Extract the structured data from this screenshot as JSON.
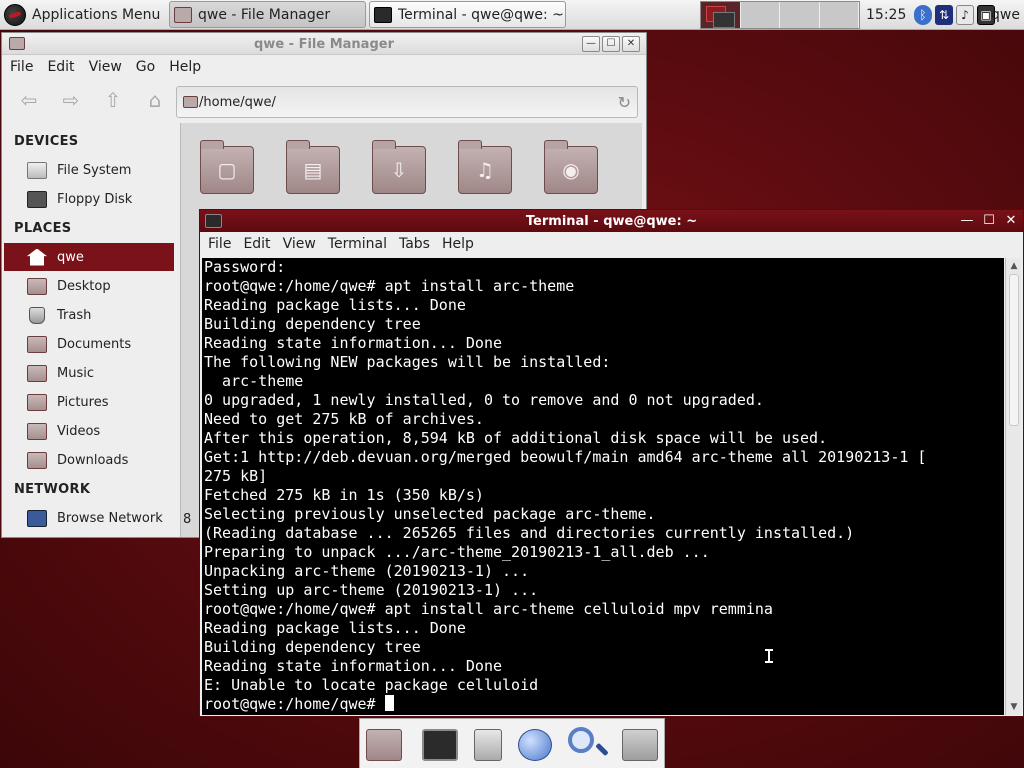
{
  "panel": {
    "app_menu_label": "Applications Menu",
    "tasks": [
      {
        "label": "qwe - File Manager",
        "icon": "file-manager-icon"
      },
      {
        "label": "Terminal - qwe@qwe: ~",
        "icon": "terminal-icon"
      }
    ],
    "clock": "15:25",
    "user": "qwe"
  },
  "file_manager": {
    "title": "qwe - File Manager",
    "menu": [
      "File",
      "Edit",
      "View",
      "Go",
      "Help"
    ],
    "path": "/home/qwe/",
    "sidebar": {
      "devices_header": "DEVICES",
      "devices": [
        {
          "label": "File System",
          "icon": "drive-icon"
        },
        {
          "label": "Floppy Disk",
          "icon": "floppy-icon"
        }
      ],
      "places_header": "PLACES",
      "places": [
        {
          "label": "qwe",
          "icon": "home-icon",
          "selected": true
        },
        {
          "label": "Desktop",
          "icon": "folder-icon"
        },
        {
          "label": "Trash",
          "icon": "trash-icon"
        },
        {
          "label": "Documents",
          "icon": "folder-icon"
        },
        {
          "label": "Music",
          "icon": "folder-icon"
        },
        {
          "label": "Pictures",
          "icon": "folder-icon"
        },
        {
          "label": "Videos",
          "icon": "folder-icon"
        },
        {
          "label": "Downloads",
          "icon": "folder-icon"
        }
      ],
      "network_header": "NETWORK",
      "network": [
        {
          "label": "Browse Network",
          "icon": "network-icon"
        }
      ]
    },
    "status_fragment": "8",
    "accent_color": "#7a1219"
  },
  "terminal": {
    "title": "Terminal - qwe@qwe: ~",
    "menu": [
      "File",
      "Edit",
      "View",
      "Terminal",
      "Tabs",
      "Help"
    ],
    "lines": [
      "Password:",
      "root@qwe:/home/qwe# apt install arc-theme",
      "Reading package lists... Done",
      "Building dependency tree",
      "Reading state information... Done",
      "The following NEW packages will be installed:",
      "  arc-theme",
      "0 upgraded, 1 newly installed, 0 to remove and 0 not upgraded.",
      "Need to get 275 kB of archives.",
      "After this operation, 8,594 kB of additional disk space will be used.",
      "Get:1 http://deb.devuan.org/merged beowulf/main amd64 arc-theme all 20190213-1 [",
      "275 kB]",
      "Fetched 275 kB in 1s (350 kB/s)",
      "Selecting previously unselected package arc-theme.",
      "(Reading database ... 265265 files and directories currently installed.)",
      "Preparing to unpack .../arc-theme_20190213-1_all.deb ...",
      "Unpacking arc-theme (20190213-1) ...",
      "Setting up arc-theme (20190213-1) ...",
      "root@qwe:/home/qwe# apt install arc-theme celluloid mpv remmina",
      "Reading package lists... Done",
      "Building dependency tree",
      "Reading state information... Done",
      "E: Unable to locate package celluloid"
    ],
    "prompt": "root@qwe:/home/qwe# ",
    "titlebar_color": "#6a0e14"
  },
  "dock": {
    "items": [
      "home-folder-icon",
      "terminal-icon",
      "file-cabinet-icon",
      "web-browser-icon",
      "search-icon",
      "folder-icon"
    ]
  }
}
